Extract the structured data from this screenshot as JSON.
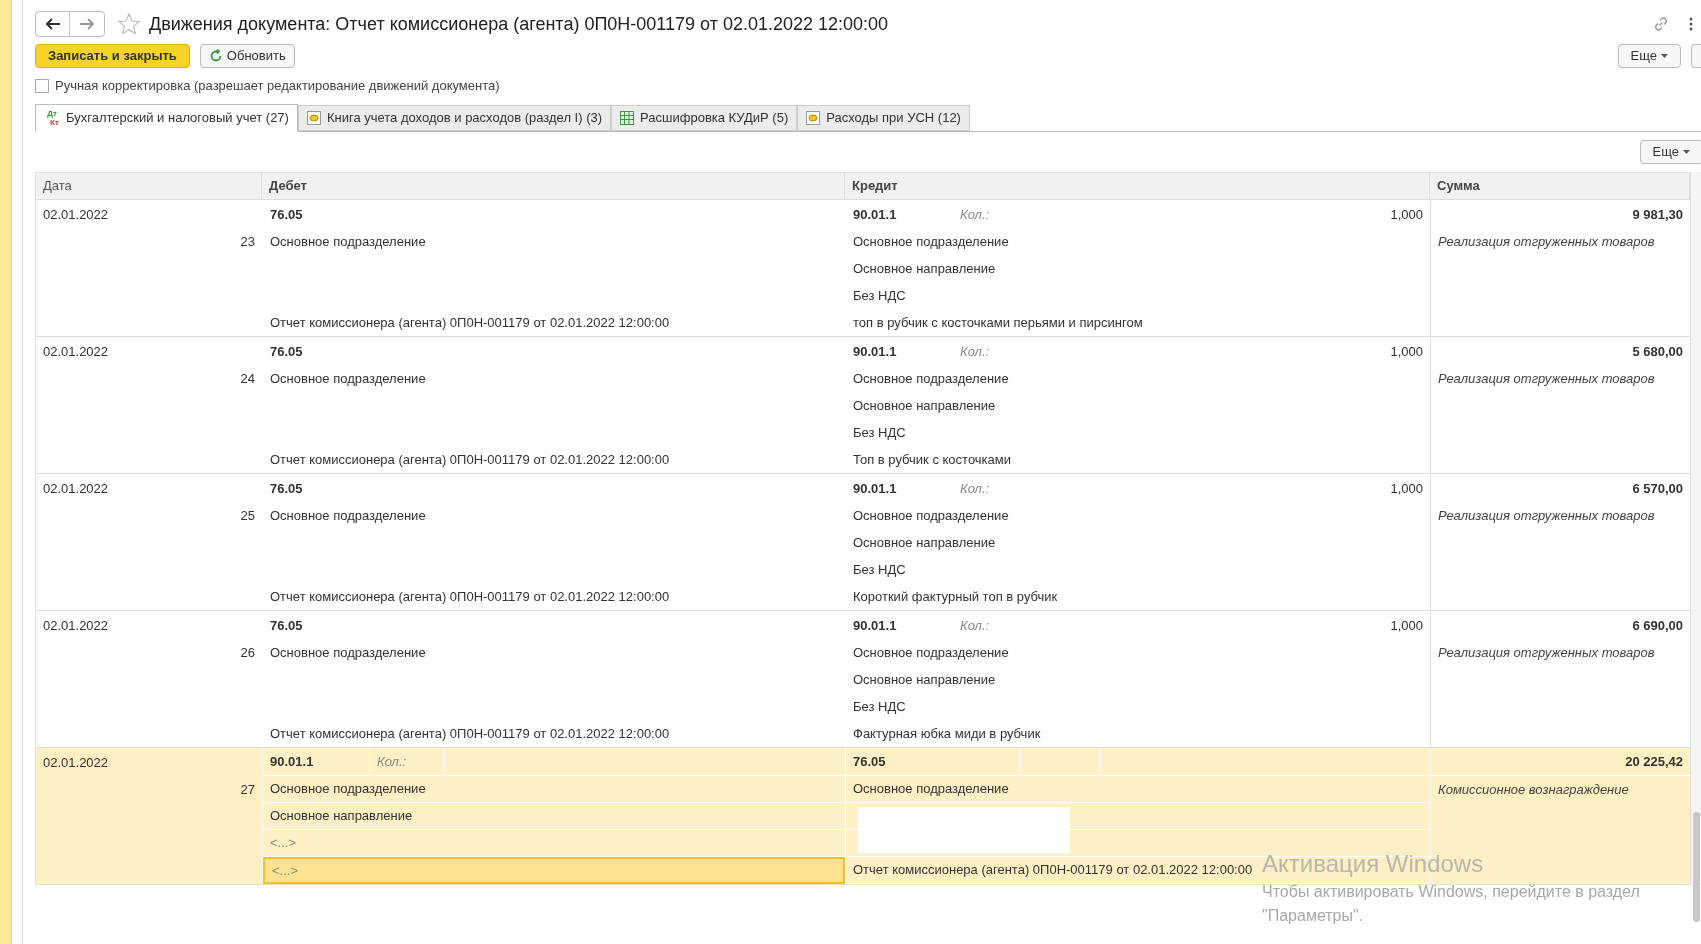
{
  "window": {
    "title": "Движения документа: Отчет комиссионера (агента) 0П0Н-001179 от 02.01.2022 12:00:00"
  },
  "toolbar": {
    "save_button": "Записать и закрыть",
    "refresh_button": "Обновить",
    "more_button": "Еще"
  },
  "manual_edit": {
    "label": "Ручная корректировка (разрешает редактирование движений документа)",
    "checked": false
  },
  "tabs": [
    {
      "label": "Бухгалтерский и налоговый учет (27)",
      "kind": "entries",
      "icon_top": "Дт",
      "icon_bottom": "Кт",
      "selected": true
    },
    {
      "label": "Книга учета доходов и расходов (раздел I) (3)",
      "kind": "register",
      "selected": false
    },
    {
      "label": "Расшифровка КУДиР (5)",
      "kind": "table",
      "selected": false
    },
    {
      "label": "Расходы при УСН (12)",
      "kind": "register",
      "selected": false
    }
  ],
  "table_more_button": "Еще",
  "table": {
    "columns": [
      "Дата",
      "Дебет",
      "Кредит",
      "Сумма"
    ],
    "rows": [
      {
        "date": "02.01.2022",
        "number": "23",
        "selected": false,
        "debit": {
          "account": "76.05",
          "subconto_1": "Основное подразделение",
          "document": "Отчет комиссионера (агента) 0П0Н-001179 от 02.01.2022 12:00:00"
        },
        "credit": {
          "account": "90.01.1",
          "qty_label": "Кол.:",
          "qty": "1,000",
          "subconto_1": "Основное подразделение",
          "subconto_2": "Основное направление",
          "subconto_3": "Без НДС",
          "document": "топ в рубчик с косточками перьями и пирсингом"
        },
        "sum": "9 981,30",
        "content": "Реализация отгруженных товаров"
      },
      {
        "date": "02.01.2022",
        "number": "24",
        "selected": false,
        "debit": {
          "account": "76.05",
          "subconto_1": "Основное подразделение",
          "document": "Отчет комиссионера (агента) 0П0Н-001179 от 02.01.2022 12:00:00"
        },
        "credit": {
          "account": "90.01.1",
          "qty_label": "Кол.:",
          "qty": "1,000",
          "subconto_1": "Основное подразделение",
          "subconto_2": "Основное направление",
          "subconto_3": "Без НДС",
          "document": "Топ в рубчик с косточками"
        },
        "sum": "5 680,00",
        "content": "Реализация отгруженных товаров"
      },
      {
        "date": "02.01.2022",
        "number": "25",
        "selected": false,
        "debit": {
          "account": "76.05",
          "subconto_1": "Основное подразделение",
          "document": "Отчет комиссионера (агента) 0П0Н-001179 от 02.01.2022 12:00:00"
        },
        "credit": {
          "account": "90.01.1",
          "qty_label": "Кол.:",
          "qty": "1,000",
          "subconto_1": "Основное подразделение",
          "subconto_2": "Основное направление",
          "subconto_3": "Без НДС",
          "document": "Короткий фактурный топ в рубчик"
        },
        "sum": "6 570,00",
        "content": "Реализация отгруженных товаров"
      },
      {
        "date": "02.01.2022",
        "number": "26",
        "selected": false,
        "debit": {
          "account": "76.05",
          "subconto_1": "Основное подразделение",
          "document": "Отчет комиссионера (агента) 0П0Н-001179 от 02.01.2022 12:00:00"
        },
        "credit": {
          "account": "90.01.1",
          "qty_label": "Кол.:",
          "qty": "1,000",
          "subconto_1": "Основное подразделение",
          "subconto_2": "Основное направление",
          "subconto_3": "Без НДС",
          "document": "Фактурная юбка миди в рубчик"
        },
        "sum": "6 690,00",
        "content": "Реализация отгруженных товаров"
      },
      {
        "date": "02.01.2022",
        "number": "27",
        "selected": true,
        "debit": {
          "account": "90.01.1",
          "qty_label": "Кол.:",
          "subconto_1": "Основное подразделение",
          "subconto_2": "Основное направление",
          "subconto_3": "<...>",
          "document": "<...>"
        },
        "credit": {
          "account": "76.05",
          "subconto_1": "Основное подразделение",
          "document": "Отчет комиссионера (агента) 0П0Н-001179 от 02.01.2022 12:00:00"
        },
        "sum": "20 225,42",
        "content": "Комиссионное вознаграждение"
      }
    ]
  },
  "os_overlay": {
    "title": "Активация Windows",
    "text": "Чтобы активировать Windows, перейдите в раздел \"Параметры\"."
  }
}
